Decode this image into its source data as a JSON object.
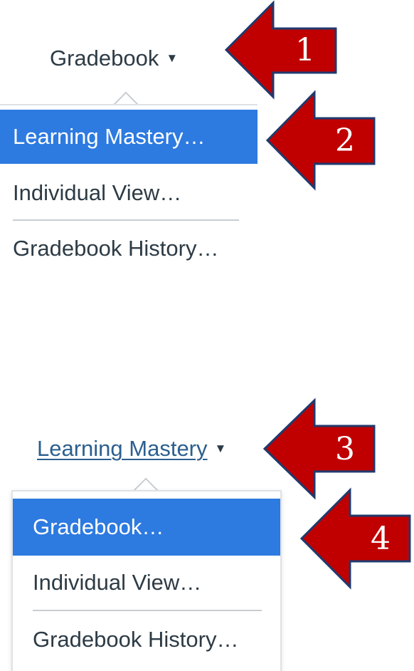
{
  "top": {
    "trigger_label": "Gradebook",
    "items": [
      {
        "label": "Learning Mastery…",
        "active": true
      },
      {
        "label": "Individual View…",
        "active": false
      },
      {
        "label": "Gradebook History…",
        "active": false
      }
    ]
  },
  "bottom": {
    "trigger_label": "Learning Mastery",
    "items": [
      {
        "label": "Gradebook…",
        "active": true
      },
      {
        "label": "Individual View…",
        "active": false
      },
      {
        "label": "Gradebook History…",
        "active": false
      }
    ]
  },
  "callouts": [
    "1",
    "2",
    "3",
    "4"
  ],
  "colors": {
    "accent": "#2d7ae0",
    "callout_fill": "#c00000",
    "callout_stroke": "#1f3a6e",
    "link": "#2c5f8f"
  },
  "icons": {
    "caret": "caret-down-icon"
  }
}
